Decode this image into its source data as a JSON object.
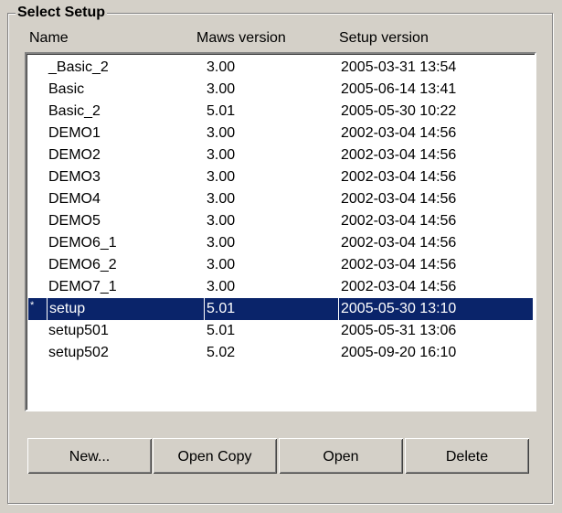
{
  "group": {
    "title": "Select Setup"
  },
  "columns": {
    "name": "Name",
    "maws_version": "Maws version",
    "setup_version": "Setup version"
  },
  "setups": [
    {
      "name": "_Basic_2",
      "maws_version": "3.00",
      "setup_version": "2005-03-31 13:54"
    },
    {
      "name": "Basic",
      "maws_version": "3.00",
      "setup_version": "2005-06-14 13:41"
    },
    {
      "name": "Basic_2",
      "maws_version": "5.01",
      "setup_version": "2005-05-30 10:22"
    },
    {
      "name": "DEMO1",
      "maws_version": "3.00",
      "setup_version": "2002-03-04 14:56"
    },
    {
      "name": "DEMO2",
      "maws_version": "3.00",
      "setup_version": "2002-03-04 14:56"
    },
    {
      "name": "DEMO3",
      "maws_version": "3.00",
      "setup_version": "2002-03-04 14:56"
    },
    {
      "name": "DEMO4",
      "maws_version": "3.00",
      "setup_version": "2002-03-04 14:56"
    },
    {
      "name": "DEMO5",
      "maws_version": "3.00",
      "setup_version": "2002-03-04 14:56"
    },
    {
      "name": "DEMO6_1",
      "maws_version": "3.00",
      "setup_version": "2002-03-04 14:56"
    },
    {
      "name": "DEMO6_2",
      "maws_version": "3.00",
      "setup_version": "2002-03-04 14:56"
    },
    {
      "name": "DEMO7_1",
      "maws_version": "3.00",
      "setup_version": "2002-03-04 14:56"
    },
    {
      "name": "setup",
      "maws_version": "5.01",
      "setup_version": "2005-05-30 13:10",
      "selected": true,
      "marker": "*"
    },
    {
      "name": "setup501",
      "maws_version": "5.01",
      "setup_version": "2005-05-31 13:06"
    },
    {
      "name": "setup502",
      "maws_version": "5.02",
      "setup_version": "2005-09-20 16:10"
    }
  ],
  "buttons": {
    "new_label": "New...",
    "open_copy_label": "Open Copy",
    "open_label": "Open",
    "delete_label": "Delete"
  },
  "colors": {
    "selection_background": "#0a246a",
    "window_background": "#d4d0c8"
  }
}
